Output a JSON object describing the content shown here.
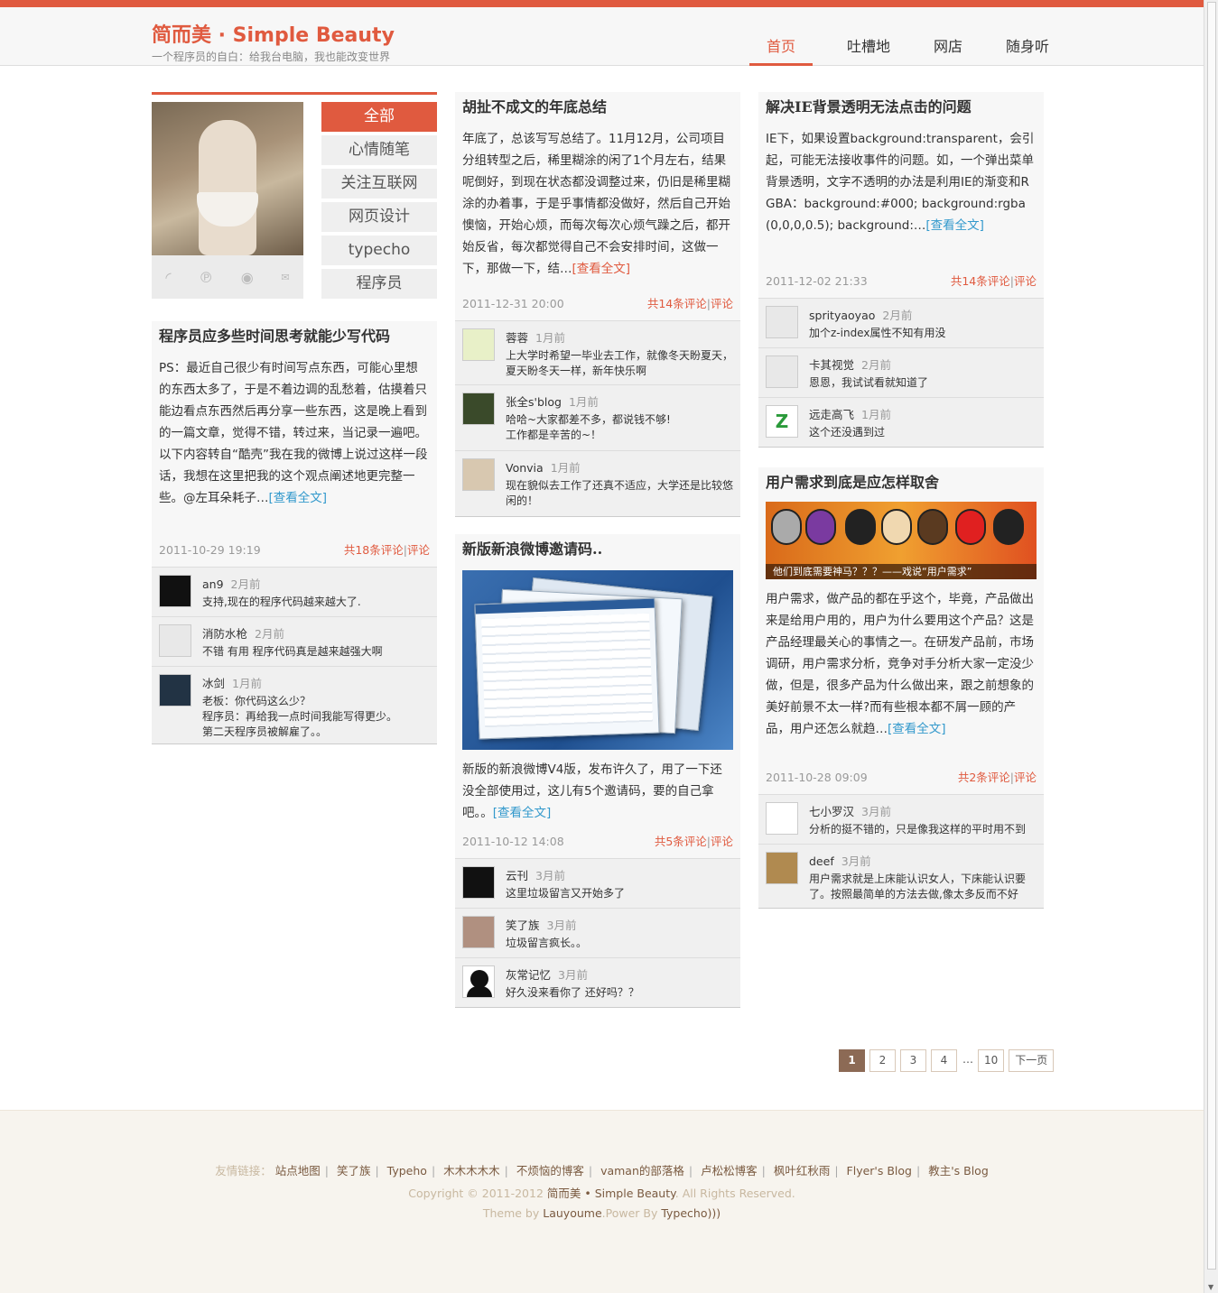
{
  "header": {
    "logo": "简而美 · Simple Beauty",
    "tagline": "一个程序员的自白：给我台电脑，我也能改变世界",
    "nav": [
      "首页",
      "吐槽地",
      "网店",
      "随身听"
    ]
  },
  "sidebar": {
    "categories": [
      "全部",
      "心情随笔",
      "关注互联网",
      "网页设计",
      "typecho",
      "程序员"
    ],
    "social_icons": [
      "rss-icon",
      "pinboard-icon",
      "weibo-icon",
      "mail-icon"
    ]
  },
  "posts": {
    "p1": {
      "title": "程序员应多些时间思考就能少写代码",
      "body": "PS：最近自己很少有时间写点东西，可能心里想的东西太多了，于是不着边调的乱愁着，估摸着只能边看点东西然后再分享一些东西，这是晚上看到的一篇文章，觉得不错，转过来，当记录一遍吧。以下内容转自“酷壳”我在我的微博上说过这样一段话，我想在这里把我的这个观点阐述地更完整一些。@左耳朵耗子…",
      "more": "[查看全文]",
      "date": "2011-10-29 19:19",
      "count": "共18条评论",
      "comment_link": "评论",
      "comments": [
        {
          "name": "an9",
          "ago": "2月前",
          "text": "支持,现在的程序代码越来越大了."
        },
        {
          "name": "消防水枪",
          "ago": "2月前",
          "text": "不错 有用 程序代码真是越来越强大啊"
        },
        {
          "name": "冰剑",
          "ago": "1月前",
          "text": "老板：你代码这么少？\n程序员：再给我一点时间我能写得更少。\n第二天程序员被解雇了。。"
        }
      ]
    },
    "p2": {
      "title": "胡扯不成文的年底总结",
      "body": "年底了，总该写写总结了。11月12月，公司项目分组转型之后，稀里糊涂的闲了1个月左右，结果呢倒好，到现在状态都没调整过来，仍旧是稀里糊涂的办着事，于是乎事情都没做好，然后自己开始懊恼，开始心烦，而每次每次心烦气躁之后，都开始反省，每次都觉得自己不会安排时间，这做一下，那做一下，结…",
      "more": "[查看全文]",
      "date": "2011-12-31 20:00",
      "count": "共14条评论",
      "comment_link": "评论",
      "comments": [
        {
          "name": "蓉蓉",
          "ago": "1月前",
          "text": "上大学时希望一毕业去工作，就像冬天盼夏天，夏天盼冬天一样，新年快乐啊"
        },
        {
          "name": "张全s'blog",
          "ago": "1月前",
          "text": "哈哈~大家都差不多，都说钱不够!\n工作都是辛苦的~！"
        },
        {
          "name": "Vonvia",
          "ago": "1月前",
          "text": "现在貌似去工作了还真不适应，大学还是比较悠闲的！"
        }
      ]
    },
    "p3": {
      "title": "新版新浪微博邀请码..",
      "body": "新版的新浪微博V4版，发布许久了，用了一下还没全部使用过，这儿有5个邀请码，要的自己拿吧。。",
      "more": "[查看全文]",
      "date": "2011-10-12 14:08",
      "count": "共5条评论",
      "comment_link": "评论",
      "comments": [
        {
          "name": "云刊",
          "ago": "3月前",
          "text": "这里垃圾留言又开始多了"
        },
        {
          "name": "笑了族",
          "ago": "3月前",
          "text": "垃圾留言疯长。。"
        },
        {
          "name": "灰常记忆",
          "ago": "3月前",
          "text": "好久没来看你了 还好吗？？"
        }
      ]
    },
    "p4": {
      "title": "解决IE背景透明无法点击的问题",
      "body": "IE下，如果设置background:transparent，会引起，可能无法接收事件的问题。如，一个弹出菜单背景透明，文字不透明的办法是利用IE的渐变和RGBA：background:#000; background:rgba(0,0,0,0.5); background:…",
      "more": "[查看全文]",
      "date": "2011-12-02 21:33",
      "count": "共14条评论",
      "comment_link": "评论",
      "comments": [
        {
          "name": "sprityaoyao",
          "ago": "2月前",
          "text": "加个z-index属性不知有用没"
        },
        {
          "name": "卡其视觉",
          "ago": "2月前",
          "text": "恩恩，我试试看就知道了"
        },
        {
          "name": "远走高飞",
          "ago": "1月前",
          "text": "这个还没遇到过"
        }
      ]
    },
    "p5": {
      "title": "用户需求到底是应怎样取舍",
      "banner_caption": "他们到底需要神马？？？——戏说“用户需求”",
      "body": "用户需求，做产品的都在乎这个，毕竟，产品做出来是给用户用的，用户为什么要用这个产品？这是产品经理最关心的事情之一。在研发产品前，市场调研，用户需求分析，竞争对手分析大家一定没少做，但是，很多产品为什么做出来，跟之前想象的美好前景不太一样?而有些根本都不屑一顾的产品，用户还怎么就趋…",
      "more": "[查看全文]",
      "date": "2011-10-28 09:09",
      "count": "共2条评论",
      "comment_link": "评论",
      "comments": [
        {
          "name": "七小罗汉",
          "ago": "3月前",
          "text": "分析的挺不错的，只是像我这样的平时用不到"
        },
        {
          "name": "deef",
          "ago": "3月前",
          "text": "用户需求就是上床能认识女人，下床能认识要了。按照最简单的方法去做,像太多反而不好"
        }
      ]
    }
  },
  "pager": [
    "1",
    "2",
    "3",
    "4",
    "…",
    "10",
    "下一页"
  ],
  "footer": {
    "links_label": "友情链接：",
    "links": [
      "站点地图",
      "笑了族",
      "Typeho",
      "木木木木木",
      "不烦恼的博客",
      "vaman的部落格",
      "卢松松博客",
      "枫叶红秋雨",
      "Flyer's Blog",
      "教主's Blog"
    ],
    "copyright_pre": "Copyright © 2011-2012",
    "site": "简而美 • Simple Beauty",
    "rights": ". All Rights Reserved.",
    "theme_pre": "Theme by",
    "theme_author": "Lauyoume",
    "power_pre": ".Power By",
    "power": "Typecho)))"
  },
  "colors": {
    "accent": "#e05a3f",
    "link": "#3399cc",
    "card": "#f7f7f7"
  }
}
